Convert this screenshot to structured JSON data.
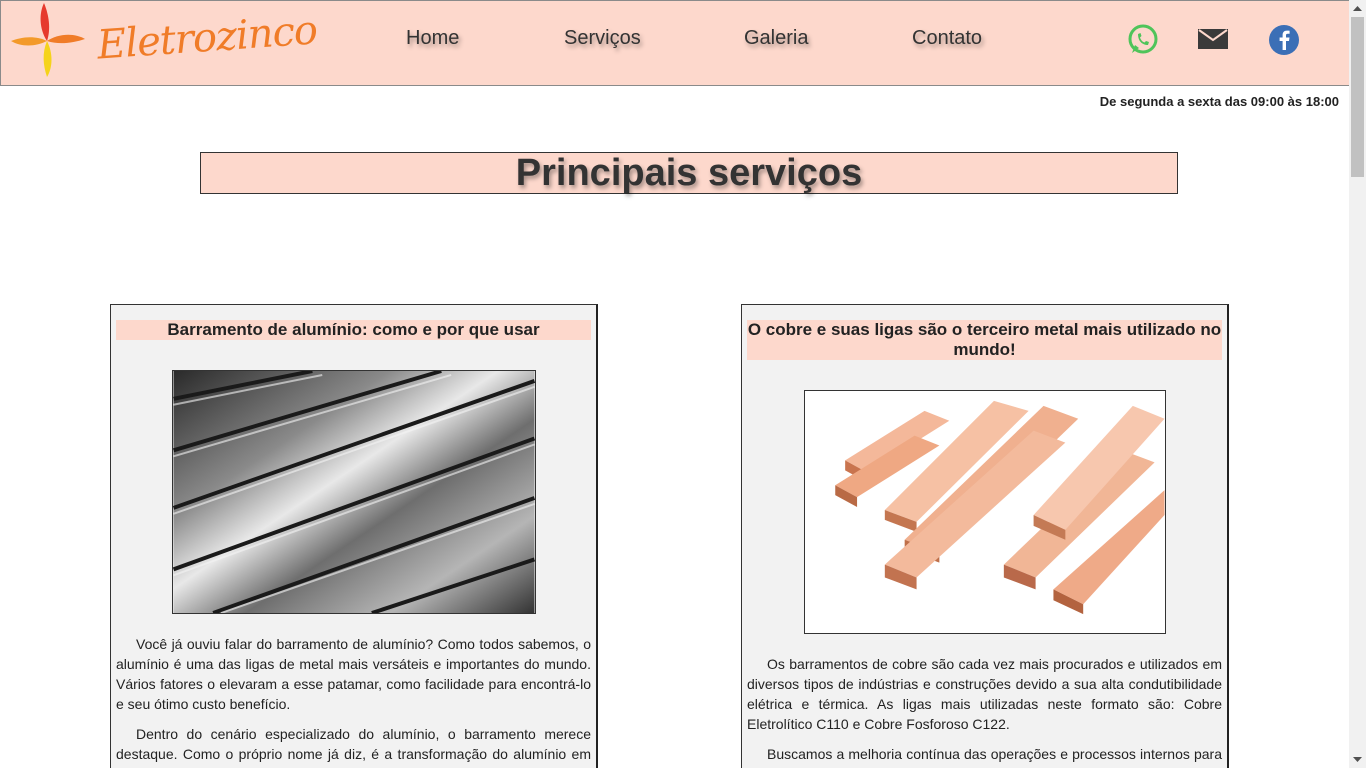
{
  "brand": {
    "name": "Eletrozinco"
  },
  "nav": {
    "items": [
      "Home",
      "Serviços",
      "Galeria",
      "Contato"
    ]
  },
  "social": {
    "whatsapp": "whatsapp-icon",
    "email": "mail-icon",
    "facebook": "facebook-icon"
  },
  "hours": "De segunda a sexta das 09:00 às 18:00",
  "main": {
    "title": "Principais serviços"
  },
  "cards": [
    {
      "title": "Barramento de alumínio: como e por que usar",
      "image": "aluminum-bars-photo",
      "paragraphs": [
        "Você já ouviu falar do barramento de alumínio? Como todos sabemos, o alumínio é uma das ligas de metal mais versáteis e importantes do mundo. Vários fatores o elevaram a esse patamar, como facilidade para encontrá-lo e seu ótimo custo benefício.",
        "Dentro do cenário especializado do alumínio, o barramento merece destaque. Como o próprio nome já diz, é a transformação do alumínio em barras para serem utilizadas em diversas aplicações."
      ]
    },
    {
      "title": "O cobre e suas ligas são o terceiro metal mais utilizado no mundo!",
      "image": "copper-bars-photo",
      "paragraphs": [
        "Os barramentos de cobre são cada vez mais procurados e utilizados em diversos tipos de indústrias e construções devido a sua alta condutibilidade elétrica e térmica. As ligas mais utilizadas neste formato são: Cobre Eletrolítico C110 e Cobre Fosforoso C122.",
        "Buscamos a melhoria contínua das operações e processos internos para garantir a qualidade e a excelência dos nossos barramentos de cobre."
      ]
    }
  ],
  "colors": {
    "nav_bg": "#fdd8cc",
    "brand_orange": "#f07c28",
    "whatsapp_green": "#4fc45a",
    "facebook_blue": "#3b6fb6"
  }
}
